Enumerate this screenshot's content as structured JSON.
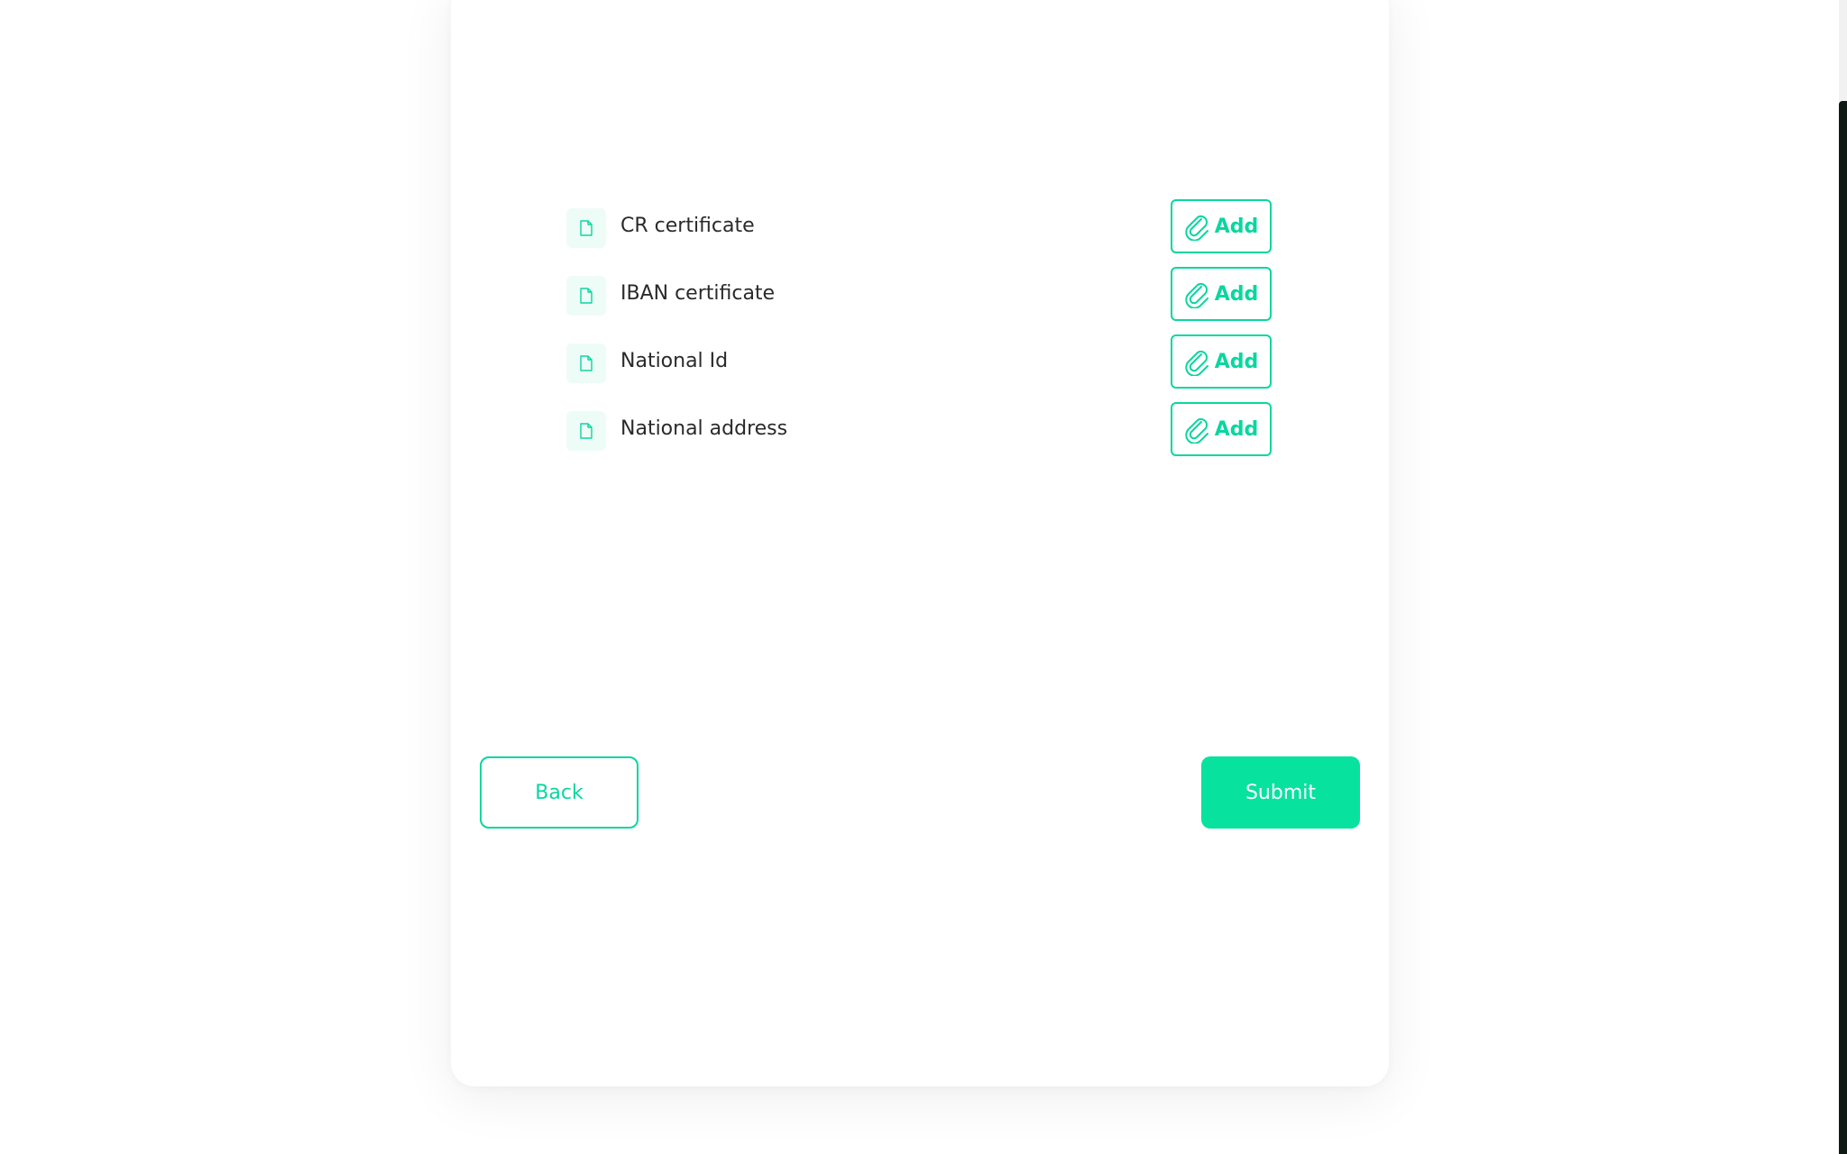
{
  "documents": [
    {
      "label": "CR certificate",
      "add_label": "Add"
    },
    {
      "label": "IBAN certificate",
      "add_label": "Add"
    },
    {
      "label": "National Id",
      "add_label": "Add"
    },
    {
      "label": "National address",
      "add_label": "Add"
    }
  ],
  "actions": {
    "back_label": "Back",
    "submit_label": "Submit"
  },
  "colors": {
    "accent": "#0ad6a0",
    "submit_bg": "#07e29f",
    "icon_bg": "#eefcf7",
    "text": "#2a2a2a"
  },
  "icons": {
    "document": "file-icon",
    "attach": "paperclip-icon"
  }
}
